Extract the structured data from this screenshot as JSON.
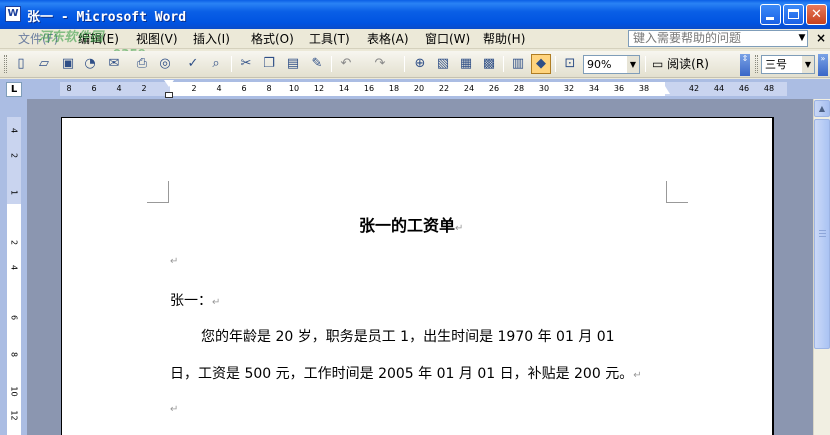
{
  "window": {
    "title": "张一 - Microsoft Word",
    "app_icon": "W",
    "minimize_icon": "minimize-icon",
    "maximize_icon": "maximize-icon",
    "close_glyph": "✕"
  },
  "watermark": {
    "line1": "河东软件园",
    "line2": "www.pc0359.cn"
  },
  "menu": {
    "items": [
      "文件(F)",
      "编辑(E)",
      "视图(V)",
      "插入(I)",
      "格式(O)",
      "工具(T)",
      "表格(A)",
      "窗口(W)",
      "帮助(H)"
    ],
    "help_placeholder": "键入需要帮助的问题",
    "doc_close": "×"
  },
  "toolbar": {
    "icons": [
      "new-icon",
      "open-icon",
      "save-icon",
      "permission-icon",
      "email-icon",
      "print-icon",
      "print-preview-icon",
      "spelling-icon",
      "research-icon",
      "cut-icon",
      "copy-icon",
      "paste-icon",
      "format-painter-icon",
      "undo-icon",
      "redo-icon",
      "hyperlink-icon",
      "tables-borders-icon",
      "insert-table-icon",
      "insert-excel-icon",
      "columns-icon",
      "drawing-icon",
      "document-map-icon",
      "show-hide-icon"
    ],
    "zoom": "90%",
    "read_label": "阅读(R)",
    "font_size": "三号",
    "font_size_button_glyph": "⇕"
  },
  "ruler": {
    "tab_selector": "L",
    "h_ticks": [
      "8",
      "6",
      "4",
      "2",
      "2",
      "4",
      "6",
      "8",
      "10",
      "12",
      "14",
      "16",
      "18",
      "20",
      "22",
      "24",
      "26",
      "28",
      "30",
      "32",
      "34",
      "36",
      "38",
      "42",
      "44",
      "46",
      "48"
    ],
    "v_ticks": [
      "4",
      "2",
      "1",
      "2",
      "4",
      "6",
      "8",
      "10",
      "12"
    ]
  },
  "document": {
    "title": "张一的工资单",
    "para_mark": "↵",
    "salutation": "张一：",
    "body_line1": "您的年龄是 20 岁，职务是员工 1，出生时间是 1970 年 01 月 01",
    "body_line2": "日，工资是 500 元，工作时间是 2005 年 01 月 01 日，补贴是 200 元。"
  },
  "scrollbar": {
    "up": "▲",
    "down": "▼"
  }
}
